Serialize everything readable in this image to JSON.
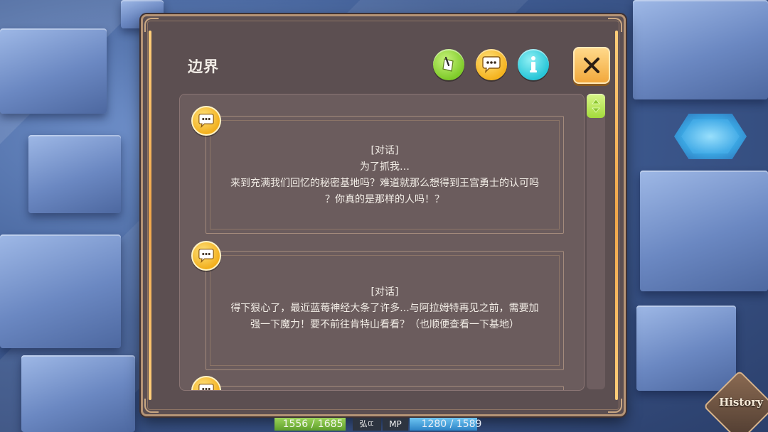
{
  "dialog": {
    "title": "边界",
    "entries": [
      {
        "tag": "[对话]",
        "lines": [
          "为了抓我…",
          "来到充满我们回忆的秘密基地吗？难道就那么想得到王宫勇士的认可吗",
          "？你真的是那样的人吗！？"
        ]
      },
      {
        "tag": "[对话]",
        "lines": [
          "得下狠心了，最近蓝莓神经大条了许多...与阿拉姆特再见之前，需要加",
          "强一下魔力！要不前往肯特山看看？（也顺便查看一下基地）"
        ]
      }
    ],
    "icons": {
      "entry_badge": "speech-bubble-icon",
      "quest": "quest-scroll-icon",
      "chat": "speech-bubble-icon",
      "info": "info-icon",
      "close": "close-icon",
      "scroll": "scroll-arrows-icon"
    }
  },
  "hud": {
    "hp_text": "1556 / 1685",
    "hp_fill": 0.923,
    "hp_suffix": "弘ㄸ",
    "mp_label": "MP",
    "mp_text": "1280 / 1589",
    "mp_fill": 0.806
  },
  "history_button": {
    "label": "History"
  },
  "colors": {
    "panel": "#5c4f51",
    "panel_border": "#b59476",
    "accent_gold": "#f2b01e",
    "accent_green": "#7fcb2a",
    "accent_cyan": "#28c6d8",
    "close_orange": "#f2a83c"
  }
}
